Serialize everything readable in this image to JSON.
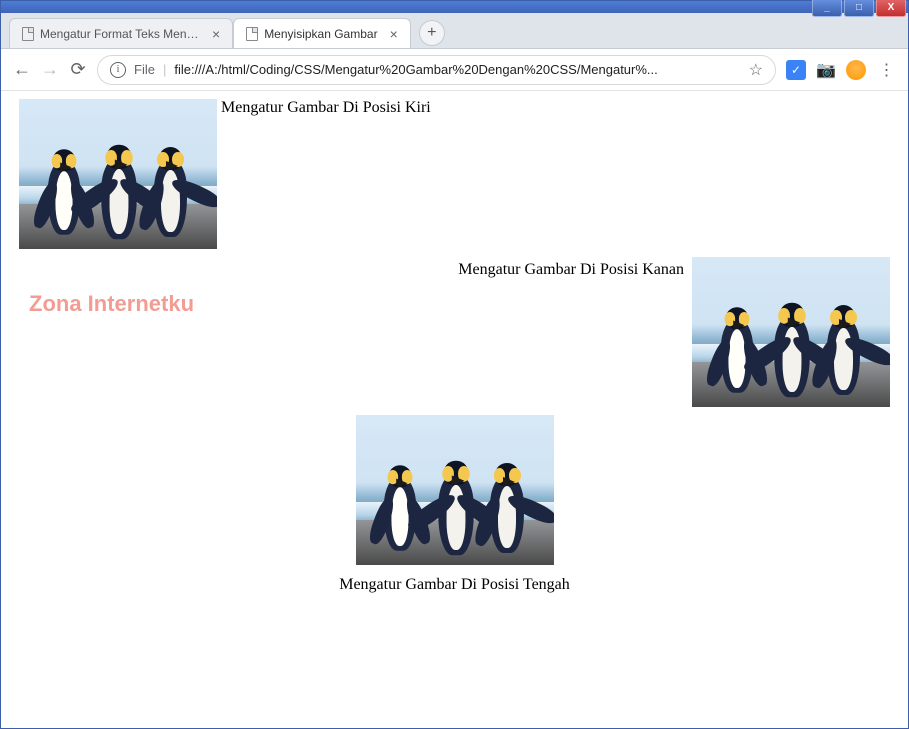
{
  "window": {
    "min_tip": "_",
    "max_tip": "□",
    "close_tip": "X"
  },
  "tabs": [
    {
      "title": "Mengatur Format Teks Menggun",
      "active": false
    },
    {
      "title": "Menyisipkan Gambar",
      "active": true
    }
  ],
  "newtab_label": "+",
  "toolbar": {
    "back": "←",
    "forward": "→",
    "reload": "⟳",
    "info_glyph": "i",
    "file_label": "File",
    "separator": "|",
    "url": "file:///A:/html/Coding/CSS/Mengatur%20Gambar%20Dengan%20CSS/Mengatur%...",
    "star": "☆",
    "ext_check": "✓",
    "camera": "📷",
    "kebab": "⋮"
  },
  "content": {
    "left_caption": "Mengatur Gambar Di Posisi Kiri",
    "right_caption": "Mengatur Gambar Di Posisi Kanan",
    "center_caption": "Mengatur Gambar Di Posisi Tengah",
    "watermark": "Zona Internetku"
  }
}
